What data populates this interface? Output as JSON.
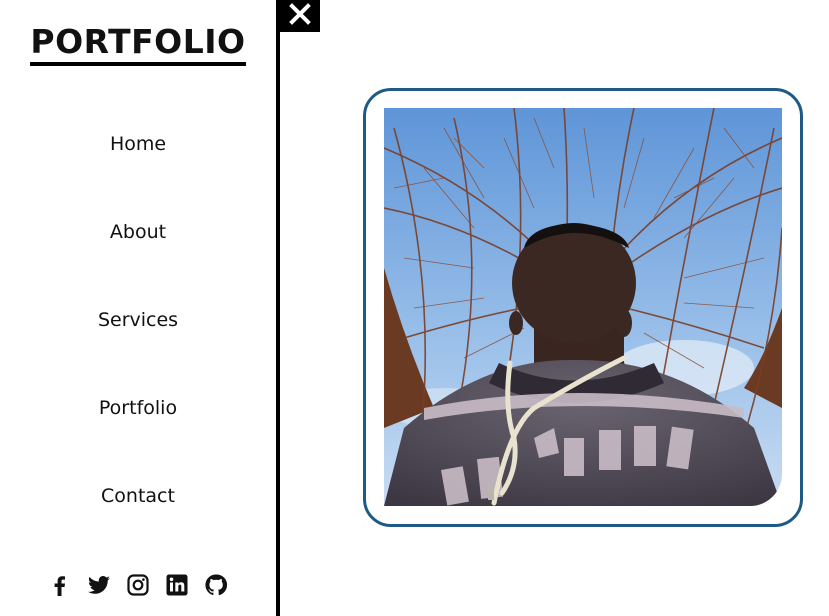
{
  "brand": {
    "title": "PORTFOLIO"
  },
  "nav": {
    "items": [
      {
        "label": "Home"
      },
      {
        "label": "About"
      },
      {
        "label": "Services"
      },
      {
        "label": "Portfolio"
      },
      {
        "label": "Contact"
      }
    ]
  },
  "socials": [
    "facebook-icon",
    "twitter-icon",
    "instagram-icon",
    "linkedin-icon",
    "github-icon"
  ],
  "close_button": {
    "icon": "close-icon"
  },
  "profile_photo": {
    "subject": "person-under-bare-trees"
  },
  "colors": {
    "frame_border": "#1e5a84",
    "sidebar_border": "#000000",
    "sky": "#7aa8e0"
  }
}
